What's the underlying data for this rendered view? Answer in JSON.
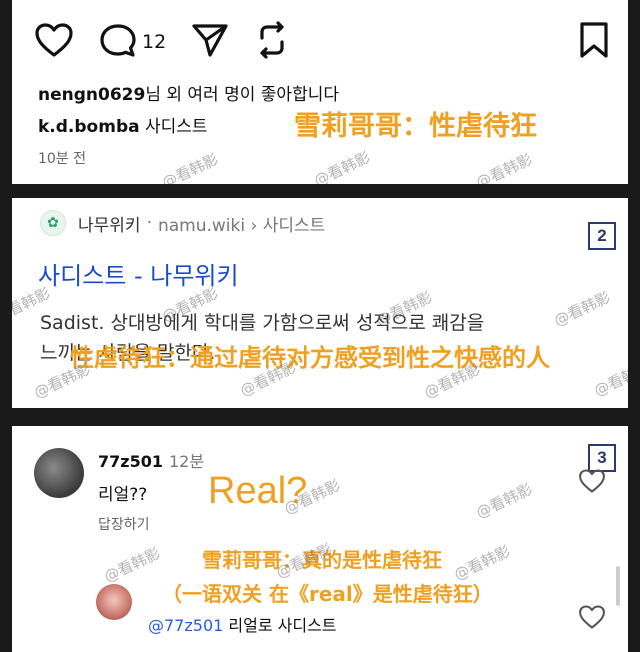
{
  "post": {
    "comment_count": "12",
    "likes_user": "nengn0629",
    "likes_rest": "님 외 여러 명이 좋아합니다",
    "caption_user": "k.d.bomba",
    "caption_text": "사디스트",
    "time": "10분 전",
    "overlay": "雪莉哥哥：性虐待狂"
  },
  "search": {
    "badge": "2",
    "site_name": "나무위키",
    "site_url": "namu.wiki › 사디스트",
    "title": "사디스트 - 나무위키",
    "snippet_line1": "Sadist. 상대방에게 학대를 가함으로써 성적으로 쾌감을",
    "snippet_line2": "느끼는 사람을 말한다.",
    "overlay": "性虐待狂：通过虐待对方感受到性之快感的人"
  },
  "comments": {
    "badge": "3",
    "username": "77z501",
    "time": "12분",
    "text": "리얼??",
    "reply_label": "답장하기",
    "overlay_real": "Real?",
    "overlay_line1": "雪莉哥哥：真的是性虐待狂",
    "overlay_line2": "（一语双关 在《real》是性虐待狂）",
    "reply_mention": "@77z501",
    "reply_text": " 리얼로 사디스트"
  },
  "watermark": "@看韩影",
  "icons": [
    "heart-icon",
    "comment-icon",
    "send-icon",
    "repost-icon",
    "bookmark-icon",
    "namu-logo-icon"
  ],
  "colors": {
    "overlay": "#f0a020",
    "link": "#1a4dc8",
    "badge": "#2b3b6b",
    "mention": "#2a5bd8"
  }
}
